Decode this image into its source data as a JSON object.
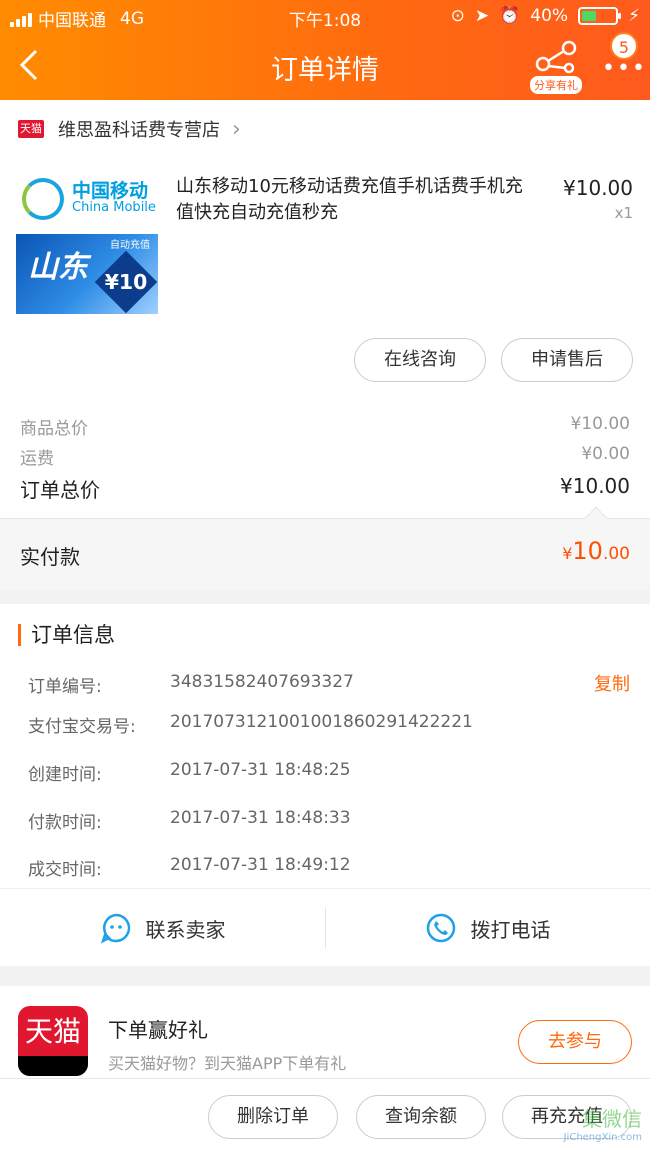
{
  "status_bar": {
    "carrier": "中国联通",
    "network": "4G",
    "time": "下午1:08",
    "battery": "40%"
  },
  "nav": {
    "title": "订单详情",
    "share_label": "分享有礼",
    "badge_count": "5"
  },
  "store": {
    "tmall_tag": "天猫",
    "name": "维思盈科话费专营店"
  },
  "product": {
    "image_brand_cn": "中国移动",
    "image_brand_en": "China Mobile",
    "image_province": "山东",
    "image_auto": "自动充值",
    "image_value": "¥10",
    "title": "山东移动10元移动话费充值手机话费手机充值快充自动充值秒充",
    "price": "¥10.00",
    "quantity": "x1",
    "buttons": {
      "consult": "在线咨询",
      "after_sale": "申请售后"
    }
  },
  "summary": {
    "goods_total_label": "商品总价",
    "goods_total_value": "¥10.00",
    "shipping_label": "运费",
    "shipping_value": "¥0.00",
    "order_total_label": "订单总价",
    "order_total_value": "¥10.00",
    "paid_label": "实付款",
    "paid_currency": "¥",
    "paid_integer": "10",
    "paid_decimal": ".00"
  },
  "order_info": {
    "heading": "订单信息",
    "copy_label": "复制",
    "rows": [
      {
        "label": "订单编号:",
        "value": "34831582407693327"
      },
      {
        "label": "支付宝交易号:",
        "value": "2017073121001001860291422221"
      },
      {
        "label": "创建时间:",
        "value": "2017-07-31 18:48:25"
      },
      {
        "label": "付款时间:",
        "value": "2017-07-31 18:48:33"
      },
      {
        "label": "成交时间:",
        "value": "2017-07-31 18:49:12"
      }
    ]
  },
  "contact": {
    "seller": "联系卖家",
    "phone": "拨打电话"
  },
  "promo": {
    "logo_text": "天猫",
    "title": "下单赢好礼",
    "subtitle": "买天猫好物？到天猫APP下单有礼",
    "join_button": "去参与"
  },
  "bottom_actions": {
    "delete": "删除订单",
    "balance": "查询余额",
    "recharge": "再充充值"
  },
  "watermark": {
    "main": "集微信",
    "sub": "JiChengXin.com"
  },
  "colors": {
    "brand_orange": "#ff6a10",
    "price_red": "#ff5000",
    "tmall_red": "#e0172f",
    "icon_blue": "#20a0e8"
  }
}
